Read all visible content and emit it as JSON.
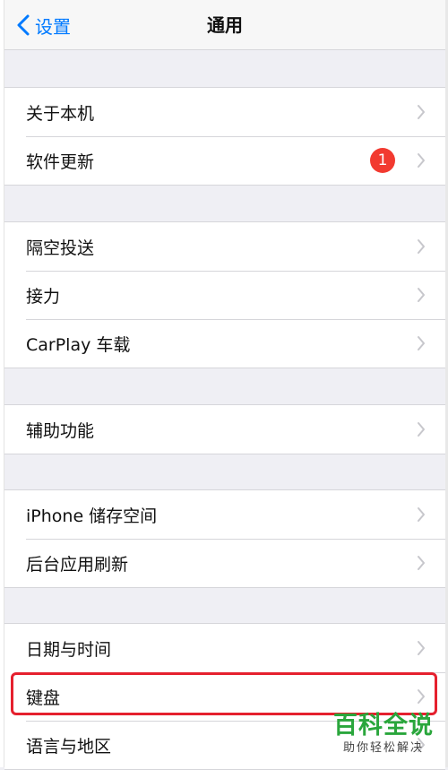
{
  "navbar": {
    "back_label": "设置",
    "title": "通用"
  },
  "groups": [
    {
      "items": [
        {
          "label": "关于本机"
        },
        {
          "label": "软件更新",
          "badge": "1"
        }
      ]
    },
    {
      "items": [
        {
          "label": "隔空投送"
        },
        {
          "label": "接力"
        },
        {
          "label": "CarPlay 车载"
        }
      ]
    },
    {
      "items": [
        {
          "label": "辅助功能"
        }
      ]
    },
    {
      "items": [
        {
          "label": "iPhone 储存空间"
        },
        {
          "label": "后台应用刷新"
        }
      ]
    },
    {
      "items": [
        {
          "label": "日期与时间"
        },
        {
          "label": "键盘"
        },
        {
          "label": "语言与地区"
        }
      ]
    }
  ],
  "watermark": {
    "main": "百科全说",
    "sub": "助你轻松解决"
  },
  "colors": {
    "accent": "#007aff",
    "badge": "#f23a30",
    "highlight": "#e5202e",
    "watermark": "#2aa63c"
  },
  "icons": {
    "back": "chevron-left-icon",
    "row": "chevron-right-icon"
  }
}
